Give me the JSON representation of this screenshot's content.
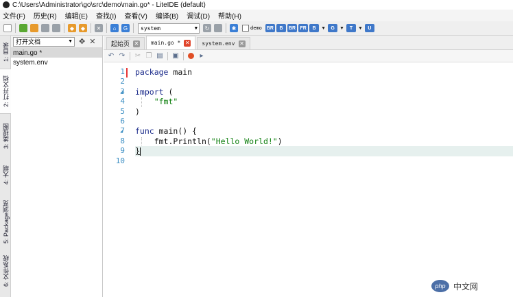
{
  "window": {
    "title": "C:\\Users\\Administrator\\go\\src\\demo\\main.go* - LiteIDE (default)"
  },
  "menu": [
    "文件(F)",
    "历史(R)",
    "编辑(E)",
    "查找(I)",
    "查看(V)",
    "编译(B)",
    "调试(D)",
    "帮助(H)"
  ],
  "toolbar": {
    "env_select": "system",
    "demo_label": "demo",
    "badges": [
      "BR",
      "B",
      "BR",
      "FR",
      "B",
      "G",
      "T",
      "U"
    ]
  },
  "vertical_tabs": [
    {
      "label": "1: 目录"
    },
    {
      "label": "2: 打开文档"
    },
    {
      "label": "3: 类视图"
    },
    {
      "label": "4: 大纲"
    },
    {
      "label": "5: Package浏览"
    },
    {
      "label": "6: 文件系统"
    }
  ],
  "doc_panel": {
    "select": "打开文档",
    "items": [
      "main.go *",
      "system.env"
    ]
  },
  "editor_tabs": [
    {
      "label": "起始页"
    },
    {
      "label": "main.go *"
    },
    {
      "label": "system.env"
    }
  ],
  "code": {
    "line_numbers": [
      "1",
      "2",
      "3",
      "4",
      "5",
      "6",
      "7",
      "8",
      "9",
      "10"
    ],
    "lines": [
      {
        "kw": "package",
        "rest": " main"
      },
      {
        "kw": "",
        "rest": ""
      },
      {
        "kw": "import",
        "rest": " ("
      },
      {
        "kw": "",
        "indent": "    ",
        "str": "\"fmt\""
      },
      {
        "kw": "",
        "rest": ")"
      },
      {
        "kw": "",
        "rest": ""
      },
      {
        "kw": "func",
        "rest": " main() {"
      },
      {
        "kw": "",
        "indent": "    ",
        "pre": "fmt.Println(",
        "str": "\"Hello World!\"",
        "post": ")"
      },
      {
        "kw": "",
        "rest": "}"
      },
      {
        "kw": "",
        "rest": ""
      }
    ]
  },
  "watermark": {
    "logo": "php",
    "text": "中文网"
  }
}
